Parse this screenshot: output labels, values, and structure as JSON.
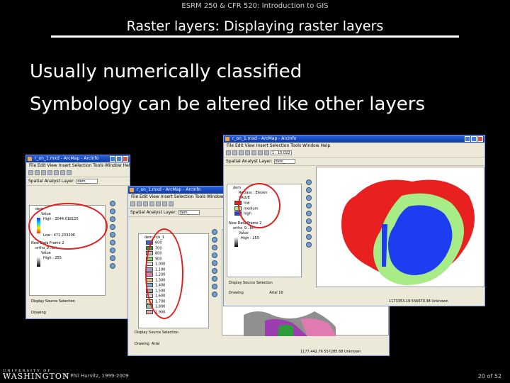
{
  "header": "ESRM 250 & CFR 520: Introduction to GIS",
  "title": "Raster layers: Displaying raster layers",
  "bullets": [
    "Usually numerically classified",
    "Symbology can be altered like other layers"
  ],
  "footer": {
    "logo_small": "UNIVERSITY OF",
    "logo": "WASHINGTON",
    "copyright": "© Phil Hurvitz, 1999-2009",
    "page": "20 of 52"
  },
  "windows": {
    "title": "r_on_1.mxd - ArcMap - ArcInfo",
    "menu": "File  Edit  View  Insert  Selection  Tools  Window  Help",
    "scale": "1 : 15,022",
    "spatial_analyst": "Spatial Analyst",
    "layer_label": "Layer:",
    "layer_value": "dem_",
    "tabs": [
      "Display",
      "Source",
      "Selection"
    ],
    "drawing": "Drawing",
    "font": "Arial",
    "size": "10"
  },
  "left_toc": {
    "layer": "dem",
    "value": "Value",
    "high": "High : 2044.018115",
    "low": "Low : 471.233206",
    "frame2": "New Data Frame 2",
    "ortho": "ortho_9...bil",
    "ortho_value": "Value",
    "ortho_high": "High : 255"
  },
  "middle_toc": {
    "layer": "dem_rcls_1",
    "classes": [
      "600",
      "700",
      "800",
      "900",
      "1,000",
      "1,100",
      "1,200",
      "1,300",
      "1,400",
      "1,500",
      "1,600",
      "1,700",
      "1,800",
      "1,900"
    ],
    "class_colors": [
      "#3a5fd8",
      "#2f9c3a",
      "#c3c3c3",
      "#8bd16a",
      "#e0e0e0",
      "#b090d0",
      "#e07ab0",
      "#d5c07a",
      "#7ab0d0",
      "#a0a0a0",
      "#c8e0f0",
      "#f0d090",
      "#90c0a0",
      "#e0b0b0"
    ],
    "coords": "1177,442.76  557285.68 Unknown"
  },
  "right_toc": {
    "layer": "dem",
    "header": "Reclass : Eleven",
    "value_label": "VALUE",
    "classes": [
      "low",
      "medium",
      "high"
    ],
    "class_colors": [
      "#e82020",
      "#a8ec88",
      "#1e3cf0"
    ],
    "frame2": "New Data Frame 2",
    "ortho": "ortho_9...bil",
    "ortho_value": "Value",
    "ortho_high": "High : 255",
    "coords": "1173353.19  556670.38 Unknown"
  }
}
